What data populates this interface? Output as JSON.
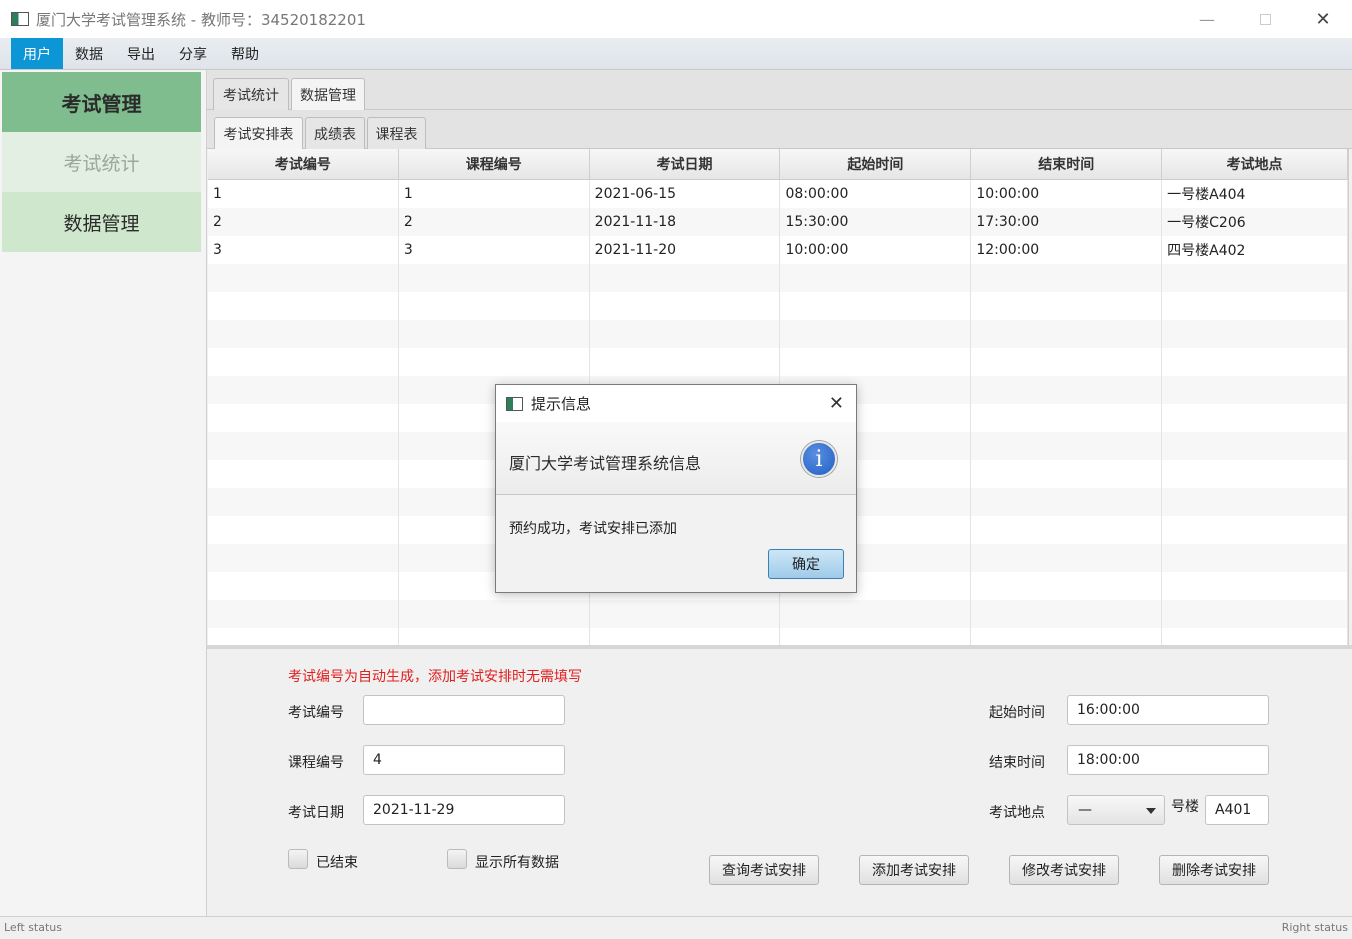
{
  "window": {
    "title": "厦门大学考试管理系统 - 教师号：34520182201",
    "minimize_glyph": "—",
    "close_glyph": "✕"
  },
  "menu": [
    "用户",
    "数据",
    "导出",
    "分享",
    "帮助"
  ],
  "sidebar": {
    "header": "考试管理",
    "items": [
      {
        "label": "考试统计"
      },
      {
        "label": "数据管理"
      }
    ]
  },
  "tabs_outer": [
    "考试统计",
    "数据管理"
  ],
  "tabs_inner": [
    "考试安排表",
    "成绩表",
    "课程表"
  ],
  "table": {
    "columns": [
      "考试编号",
      "课程编号",
      "考试日期",
      "起始时间",
      "结束时间",
      "考试地点"
    ],
    "rows": [
      [
        "1",
        "1",
        "2021-06-15",
        "08:00:00",
        "10:00:00",
        "一号楼A404"
      ],
      [
        "2",
        "2",
        "2021-11-18",
        "15:30:00",
        "17:30:00",
        "一号楼C206"
      ],
      [
        "3",
        "3",
        "2021-11-20",
        "10:00:00",
        "12:00:00",
        "四号楼A402"
      ]
    ]
  },
  "form": {
    "hint": "考试编号为自动生成，添加考试安排时无需填写",
    "exam_id_label": "考试编号",
    "exam_id_value": "",
    "course_id_label": "课程编号",
    "course_id_value": "4",
    "exam_date_label": "考试日期",
    "exam_date_value": "2021-11-29",
    "start_time_label": "起始时间",
    "start_time_value": "16:00:00",
    "end_time_label": "结束时间",
    "end_time_value": "18:00:00",
    "location_label": "考试地点",
    "building_select_value": "—",
    "building_suffix": "号楼",
    "room_value": "A401",
    "finished_label": "已结束",
    "show_all_label": "显示所有数据",
    "query_button": "查询考试安排",
    "add_button": "添加考试安排",
    "modify_button": "修改考试安排",
    "delete_button": "删除考试安排"
  },
  "status": {
    "left": "Left status",
    "right": "Right status"
  },
  "dialog": {
    "title": "提示信息",
    "header": "厦门大学考试管理系统信息",
    "content": "预约成功，考试安排已添加",
    "ok_button": "确定",
    "close_glyph": "✕",
    "info_glyph": "i"
  },
  "colors": {
    "menu_active": "#0d96d6",
    "sidebar_header": "#7fbd8e",
    "sidebar_selected": "#cfe7cd",
    "hint_text": "#e02020",
    "info_icon": "#1f5fc4"
  }
}
